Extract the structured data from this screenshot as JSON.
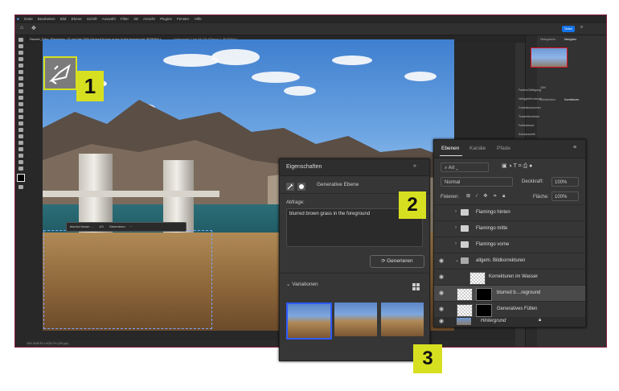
{
  "menubar": [
    "Datei",
    "Bearbeiten",
    "Bild",
    "Ebene",
    "Schrift",
    "Auswahl",
    "Filter",
    "3D",
    "Ansicht",
    "Plugins",
    "Fenster",
    "Hilfe"
  ],
  "options": {
    "share_label": "Teilen"
  },
  "tab_title": "Hoover_Dam_Flamingos_01.psd bei 16% (blurred brown grass in the foreground, RGB/8#) *",
  "tab_title_2": "Unbenannt-1 bei 66,7% (Ebene 1, RGB/8#) *",
  "genbar": {
    "text": "blurred brown ...",
    "pager": "1/3",
    "regen": "Generieren"
  },
  "status": "16%    6048 Px x 4032 Px (240 ppi)",
  "right_panel": {
    "tabs": [
      "Histogramm",
      "Navigator"
    ],
    "zoom": "16%",
    "adjustments_tabs": [
      "Bibliotheken",
      "Korrekturen"
    ],
    "adjustments": [
      "Farbton/Sättigung",
      "Helligkeit/Kontrast",
      "Gradationskurven",
      "Tonwertkorrektur",
      "Farbbalance",
      "Schwarzweiß"
    ]
  },
  "eigenschaften": {
    "title": "Eigenschaften",
    "arrows": "»",
    "layer_type": "Generative Ebene",
    "abfrage_label": "Abfrage:",
    "prompt": "blurred brown grass in the foreground",
    "generate_button": "Generieren",
    "variations_label": "Variationen"
  },
  "ebenen": {
    "tabs": [
      "Ebenen",
      "Kanäle",
      "Pfade"
    ],
    "filter": "Art",
    "blend_mode": "Normal",
    "opacity_label": "Deckkraft:",
    "opacity": "100%",
    "lock_label": "Fixieren:",
    "fill_label": "Fläche:",
    "fill": "100%",
    "layers": [
      {
        "name": "Flamingo hinten",
        "kind": "group"
      },
      {
        "name": "Flamingo mitte",
        "kind": "group"
      },
      {
        "name": "Flamingo vorne",
        "kind": "group"
      },
      {
        "name": "allgem. Bildkorrekturen",
        "kind": "group-open"
      },
      {
        "name": "Korrekturen im Wasser",
        "kind": "layer"
      },
      {
        "name": "blurred b....reground",
        "kind": "generative",
        "selected": true
      },
      {
        "name": "Generatives Füllen",
        "kind": "generative"
      },
      {
        "name": "Hintergrund",
        "kind": "background"
      }
    ]
  },
  "badges": {
    "one": "1",
    "two": "2",
    "three": "3"
  },
  "colors": {
    "badge": "#d7e020",
    "selection": "#2e5cff"
  }
}
